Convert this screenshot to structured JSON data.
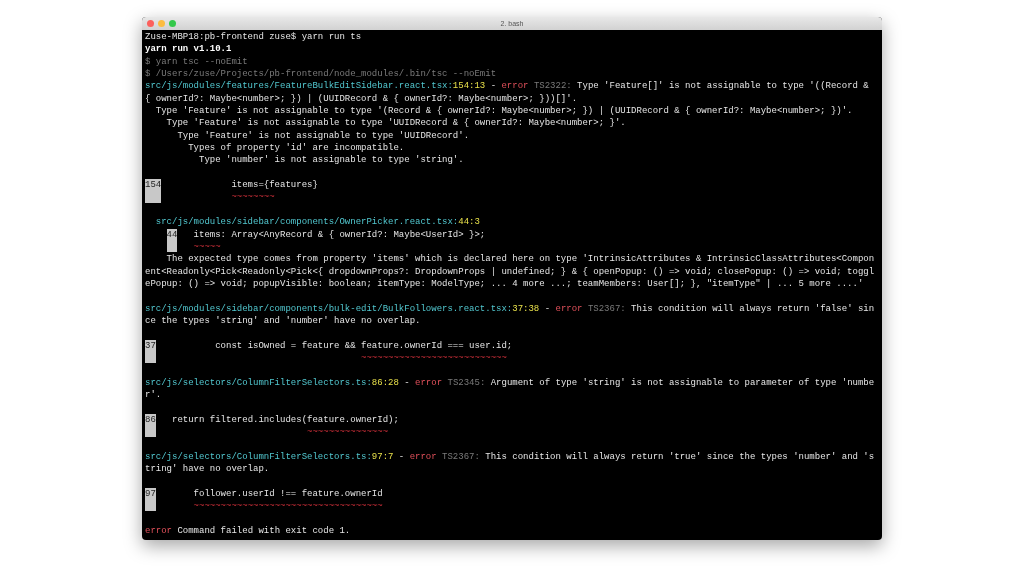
{
  "window": {
    "title": "2. bash"
  },
  "lines": [
    {
      "kind": "text",
      "segments": [
        {
          "kind": "plain",
          "text": "Zuse-MBP18:pb-frontend zuse$ yarn run ts"
        }
      ]
    },
    {
      "kind": "text",
      "segments": [
        {
          "kind": "bold",
          "text": "yarn run v1.10.1"
        }
      ]
    },
    {
      "kind": "text",
      "segments": [
        {
          "kind": "dim",
          "text": "$ yarn tsc --noEmit"
        }
      ]
    },
    {
      "kind": "text",
      "segments": [
        {
          "kind": "dim",
          "text": "$ /Users/zuse/Projects/pb-frontend/node_modules/.bin/tsc --noEmit"
        }
      ]
    },
    {
      "kind": "text",
      "segments": [
        {
          "kind": "path",
          "text": "src/js/modules/features/FeatureBulkEditSidebar.react.tsx:"
        },
        {
          "kind": "pos",
          "text": "154:13"
        },
        {
          "kind": "plain",
          "text": " - "
        },
        {
          "kind": "error",
          "text": "error"
        },
        {
          "kind": "code",
          "text": " TS2322:"
        },
        {
          "kind": "plain",
          "text": " Type 'Feature[]' is not assignable to type '((Record &"
        }
      ]
    },
    {
      "kind": "text",
      "segments": [
        {
          "kind": "plain",
          "text": "{ ownerId?: Maybe<number>; }) | (UUIDRecord & { ownerId?: Maybe<number>; }))[]'."
        }
      ]
    },
    {
      "kind": "text",
      "segments": [
        {
          "kind": "plain",
          "text": "  Type 'Feature' is not assignable to type '(Record & { ownerId?: Maybe<number>; }) | (UUIDRecord & { ownerId?: Maybe<number>; })'."
        }
      ]
    },
    {
      "kind": "text",
      "segments": [
        {
          "kind": "plain",
          "text": "    Type 'Feature' is not assignable to type 'UUIDRecord & { ownerId?: Maybe<number>; }'."
        }
      ]
    },
    {
      "kind": "text",
      "segments": [
        {
          "kind": "plain",
          "text": "      Type 'Feature' is not assignable to type 'UUIDRecord'."
        }
      ]
    },
    {
      "kind": "text",
      "segments": [
        {
          "kind": "plain",
          "text": "        Types of property 'id' are incompatible."
        }
      ]
    },
    {
      "kind": "text",
      "segments": [
        {
          "kind": "plain",
          "text": "          Type 'number' is not assignable to type 'string'."
        }
      ]
    },
    {
      "kind": "blank"
    },
    {
      "kind": "code",
      "number": "154",
      "code": "             items={features}",
      "squiggle": "             ~~~~~~~~"
    },
    {
      "kind": "blank"
    },
    {
      "kind": "text",
      "segments": [
        {
          "kind": "path",
          "text": "  src/js/modules/sidebar/components/OwnerPicker.react.tsx:"
        },
        {
          "kind": "pos",
          "text": "44:3"
        }
      ]
    },
    {
      "kind": "nested_code",
      "number": "44",
      "code": "   items: Array<AnyRecord & { ownerId?: Maybe<UserId> }>;",
      "squiggle": "   ~~~~~"
    },
    {
      "kind": "text",
      "segments": [
        {
          "kind": "plain",
          "text": "    The expected type comes from property 'items' which is declared here on type 'IntrinsicAttributes & IntrinsicClassAttributes<Compon"
        }
      ]
    },
    {
      "kind": "text",
      "segments": [
        {
          "kind": "plain",
          "text": "ent<Readonly<Pick<Readonly<Pick<{ dropdownProps?: DropdownProps | undefined; } & { openPopup: () => void; closePopup: () => void; toggl"
        }
      ]
    },
    {
      "kind": "text",
      "segments": [
        {
          "kind": "plain",
          "text": "ePopup: () => void; popupVisible: boolean; itemType: ModelType; ... 4 more ...; teamMembers: User[]; }, \"itemType\" | ... 5 more ....'"
        }
      ]
    },
    {
      "kind": "blank"
    },
    {
      "kind": "text",
      "segments": [
        {
          "kind": "path",
          "text": "src/js/modules/sidebar/components/bulk-edit/BulkFollowers.react.tsx:"
        },
        {
          "kind": "pos",
          "text": "37:38"
        },
        {
          "kind": "plain",
          "text": " - "
        },
        {
          "kind": "error",
          "text": "error"
        },
        {
          "kind": "code",
          "text": " TS2367:"
        },
        {
          "kind": "plain",
          "text": " This condition will always return 'false' sin"
        }
      ]
    },
    {
      "kind": "text",
      "segments": [
        {
          "kind": "plain",
          "text": "ce the types 'string' and 'number' have no overlap."
        }
      ]
    },
    {
      "kind": "blank"
    },
    {
      "kind": "code",
      "number": "37",
      "code": "           const isOwned = feature && feature.ownerId === user.id;",
      "squiggle": "                                      ~~~~~~~~~~~~~~~~~~~~~~~~~~~"
    },
    {
      "kind": "blank"
    },
    {
      "kind": "text",
      "segments": [
        {
          "kind": "path",
          "text": "src/js/selectors/ColumnFilterSelectors.ts:"
        },
        {
          "kind": "pos",
          "text": "86:28"
        },
        {
          "kind": "plain",
          "text": " - "
        },
        {
          "kind": "error",
          "text": "error"
        },
        {
          "kind": "code",
          "text": " TS2345:"
        },
        {
          "kind": "plain",
          "text": " Argument of type 'string' is not assignable to parameter of type 'numbe"
        }
      ]
    },
    {
      "kind": "text",
      "segments": [
        {
          "kind": "plain",
          "text": "r'."
        }
      ]
    },
    {
      "kind": "blank"
    },
    {
      "kind": "code",
      "number": "86",
      "code": "   return filtered.includes(feature.ownerId);",
      "squiggle": "                            ~~~~~~~~~~~~~~~"
    },
    {
      "kind": "blank"
    },
    {
      "kind": "text",
      "segments": [
        {
          "kind": "path",
          "text": "src/js/selectors/ColumnFilterSelectors.ts:"
        },
        {
          "kind": "pos",
          "text": "97:7"
        },
        {
          "kind": "plain",
          "text": " - "
        },
        {
          "kind": "error",
          "text": "error"
        },
        {
          "kind": "code",
          "text": " TS2367:"
        },
        {
          "kind": "plain",
          "text": " This condition will always return 'true' since the types 'number' and 's"
        }
      ]
    },
    {
      "kind": "text",
      "segments": [
        {
          "kind": "plain",
          "text": "tring' have no overlap."
        }
      ]
    },
    {
      "kind": "blank"
    },
    {
      "kind": "code",
      "number": "97",
      "code": "       follower.userId !== feature.ownerId",
      "squiggle": "       ~~~~~~~~~~~~~~~~~~~~~~~~~~~~~~~~~~~"
    },
    {
      "kind": "blank"
    },
    {
      "kind": "text",
      "segments": [
        {
          "kind": "error",
          "text": "error"
        },
        {
          "kind": "plain",
          "text": " Command failed with exit code 1."
        }
      ]
    }
  ]
}
